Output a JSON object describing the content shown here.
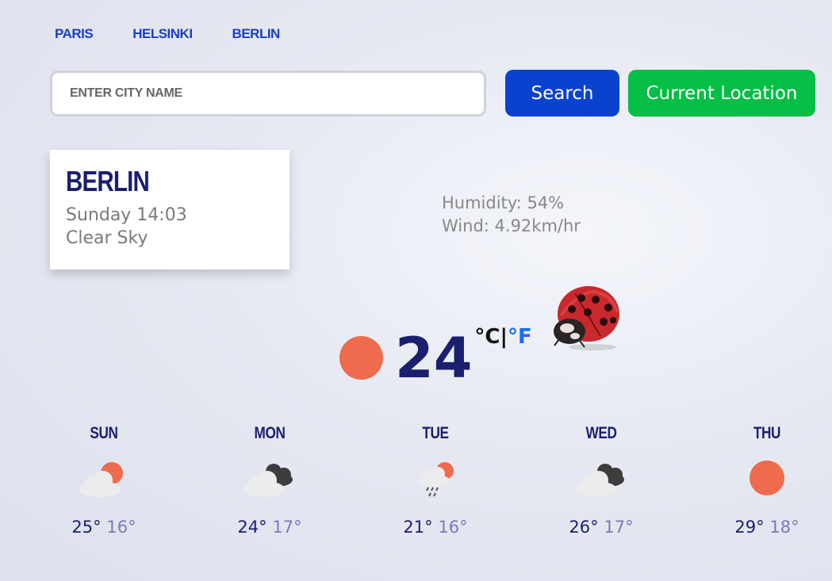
{
  "nav": {
    "cities": [
      "PARIS",
      "HELSINKI",
      "BERLIN"
    ]
  },
  "search": {
    "placeholder": "ENTER CITY NAME",
    "value": "",
    "search_label": "Search",
    "location_label": "Current Location"
  },
  "current": {
    "city": "BERLIN",
    "datetime": "Sunday 14:03",
    "description": "Clear Sky",
    "humidity": "Humidity: 54%",
    "wind": "Wind: 4.92km/hr",
    "temperature": "24",
    "unit_c": "°C",
    "unit_sep": "|",
    "unit_f": "°F",
    "icon": "sun-icon"
  },
  "forecast": [
    {
      "day": "SUN",
      "max": "25°",
      "min": "16°",
      "icon": "partly-cloudy-sun-icon"
    },
    {
      "day": "MON",
      "max": "24°",
      "min": "17°",
      "icon": "broken-clouds-icon"
    },
    {
      "day": "TUE",
      "max": "21°",
      "min": "16°",
      "icon": "rain-sun-icon"
    },
    {
      "day": "WED",
      "max": "26°",
      "min": "17°",
      "icon": "broken-clouds-icon"
    },
    {
      "day": "THU",
      "max": "29°",
      "min": "18°",
      "icon": "sun-icon"
    }
  ],
  "colors": {
    "accent_blue": "#0a42d0",
    "accent_green": "#05be45",
    "navy": "#1a1f6e",
    "sun": "#ee6b4d"
  }
}
